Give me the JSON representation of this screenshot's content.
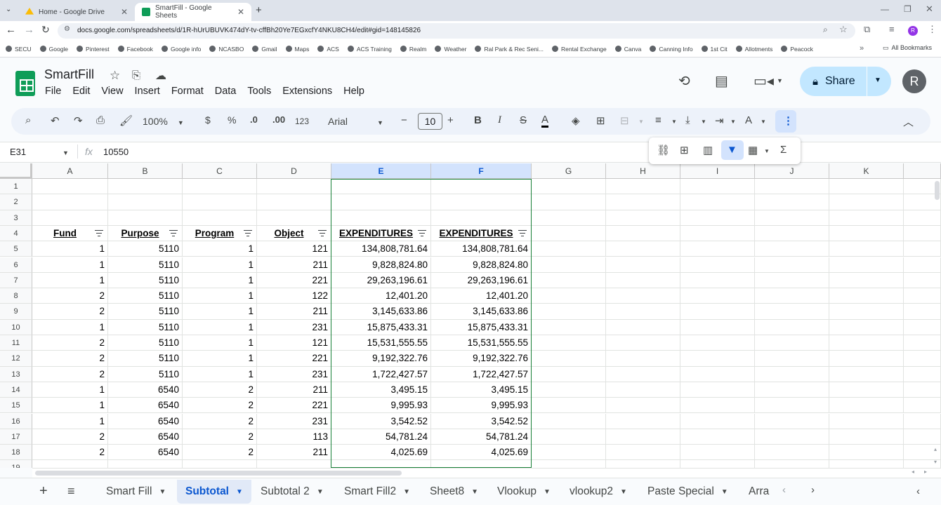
{
  "browser": {
    "tabs": [
      {
        "title": "Home - Google Drive",
        "active": false,
        "color": "#1a73e8"
      },
      {
        "title": "SmartFill - Google Sheets",
        "active": true,
        "color": "#0f9d58"
      }
    ],
    "url": "docs.google.com/spreadsheets/d/1R-hUrUBUVK474dY-tv-cffBh20Ye7EGxcfY4NKU8CH4/edit#gid=148145826",
    "bookmarks": [
      "SECU",
      "Google",
      "Pinterest",
      "Facebook",
      "Google info",
      "NCASBO",
      "Gmail",
      "Maps",
      "ACS",
      "ACS Training",
      "Realm",
      "Weather",
      "Ral Park & Rec Seni...",
      "Rental Exchange",
      "Canva",
      "Canning Info",
      "1st Cit",
      "Allotments",
      "Peacock"
    ],
    "all_bookmarks": "All Bookmarks"
  },
  "doc": {
    "title": "SmartFill",
    "menu": [
      "File",
      "Edit",
      "View",
      "Insert",
      "Format",
      "Data",
      "Tools",
      "Extensions",
      "Help"
    ],
    "share_label": "Share",
    "avatar_letter": "R"
  },
  "toolbar": {
    "zoom": "100%",
    "currency": "$",
    "percent": "%",
    "dec_decrease": ".0",
    "dec_increase": ".00",
    "format_123": "123",
    "font": "Arial",
    "font_size": "10"
  },
  "formula": {
    "cell_ref": "E31",
    "fx": "fx",
    "value": "10550"
  },
  "grid": {
    "columns": [
      "A",
      "B",
      "C",
      "D",
      "E",
      "F",
      "G",
      "H",
      "I",
      "J",
      "K"
    ],
    "selected_columns": [
      "E",
      "F"
    ],
    "row_numbers": [
      "1",
      "2",
      "3",
      "4",
      "5",
      "6",
      "7",
      "8",
      "9",
      "10",
      "11",
      "12",
      "13",
      "14",
      "15",
      "16",
      "17",
      "18",
      "19"
    ],
    "headers": [
      "Fund",
      "Purpose",
      "Program",
      "Object",
      "EXPENDITURES",
      "EXPENDITURES"
    ],
    "rows": [
      [
        "1",
        "5110",
        "1",
        "121",
        "134,808,781.64",
        "134,808,781.64"
      ],
      [
        "1",
        "5110",
        "1",
        "211",
        "9,828,824.80",
        "9,828,824.80"
      ],
      [
        "1",
        "5110",
        "1",
        "221",
        "29,263,196.61",
        "29,263,196.61"
      ],
      [
        "2",
        "5110",
        "1",
        "122",
        "12,401.20",
        "12,401.20"
      ],
      [
        "2",
        "5110",
        "1",
        "211",
        "3,145,633.86",
        "3,145,633.86"
      ],
      [
        "1",
        "5110",
        "1",
        "231",
        "15,875,433.31",
        "15,875,433.31"
      ],
      [
        "2",
        "5110",
        "1",
        "121",
        "15,531,555.55",
        "15,531,555.55"
      ],
      [
        "2",
        "5110",
        "1",
        "221",
        "9,192,322.76",
        "9,192,322.76"
      ],
      [
        "2",
        "5110",
        "1",
        "231",
        "1,722,427.57",
        "1,722,427.57"
      ],
      [
        "1",
        "6540",
        "2",
        "211",
        "3,495.15",
        "3,495.15"
      ],
      [
        "1",
        "6540",
        "2",
        "221",
        "9,995.93",
        "9,995.93"
      ],
      [
        "1",
        "6540",
        "2",
        "231",
        "3,542.52",
        "3,542.52"
      ],
      [
        "2",
        "6540",
        "2",
        "113",
        "54,781.24",
        "54,781.24"
      ],
      [
        "2",
        "6540",
        "2",
        "211",
        "4,025.69",
        "4,025.69"
      ]
    ]
  },
  "sheets": [
    {
      "name": "Smart Fill",
      "active": false
    },
    {
      "name": "Subtotal",
      "active": true
    },
    {
      "name": "Subtotal 2",
      "active": false
    },
    {
      "name": "Smart Fill2",
      "active": false
    },
    {
      "name": "Sheet8",
      "active": false
    },
    {
      "name": "Vlookup",
      "active": false
    },
    {
      "name": "vlookup2",
      "active": false
    },
    {
      "name": "Paste Special",
      "active": false
    },
    {
      "name": "Arra",
      "active": false
    }
  ]
}
